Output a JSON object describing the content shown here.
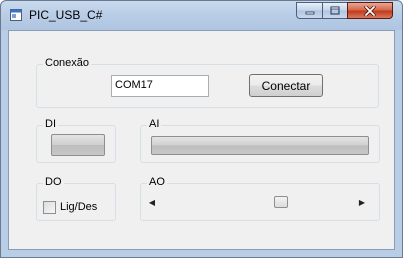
{
  "window": {
    "title": "PIC_USB_C#",
    "controls": {
      "minimize": "minimize-icon",
      "maximize": "maximize-icon",
      "close": "close-icon"
    }
  },
  "connection": {
    "group_label": "Conexão",
    "port_value": "COM17",
    "connect_button": "Conectar"
  },
  "digital_input": {
    "group_label": "DI"
  },
  "analog_input": {
    "group_label": "AI"
  },
  "digital_output": {
    "group_label": "DO",
    "checkbox_label": "Lig/Des",
    "checked": false
  },
  "analog_output": {
    "group_label": "AO",
    "slider_position_fraction": 0.63
  },
  "colors": {
    "titlebar": "#b9cde6",
    "client": "#f0f0f0",
    "close_button": "#c8452a"
  }
}
